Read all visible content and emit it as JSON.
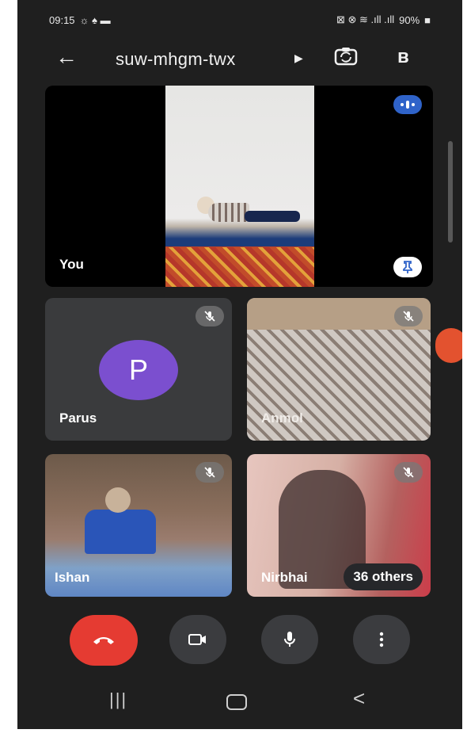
{
  "status_bar": {
    "time": "09:15",
    "right_icons": "⊠ ⊗ ≋ .ıll .ıll",
    "battery": "90%"
  },
  "app_bar": {
    "meeting_code": "suw-mhgm-twx",
    "icons": [
      "back-arrow-icon",
      "caret-right-icon",
      "camera-flip-icon",
      "bluetooth-icon"
    ]
  },
  "participants": [
    {
      "name": "You",
      "speaking": true,
      "pinned": true
    },
    {
      "name": "Parus",
      "avatar_letter": "P",
      "avatar_color": "#7b4fcf",
      "muted": true
    },
    {
      "name": "Anmol",
      "muted": true
    },
    {
      "name": "Ishan",
      "muted": true
    },
    {
      "name": "Nirbhai",
      "muted": true
    }
  ],
  "others_label": "36 others",
  "controls": {
    "end_call_color": "#e53b32",
    "items": [
      "end-call-icon",
      "camera-icon",
      "microphone-icon",
      "more-vert-icon"
    ]
  },
  "nav_bar": {
    "recent_glyph": "|||",
    "back_glyph": "<"
  }
}
